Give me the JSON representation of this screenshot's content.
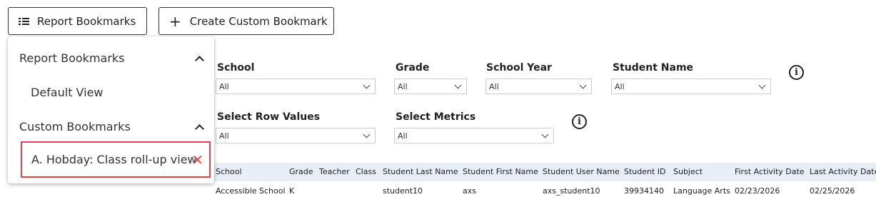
{
  "toolbar": {
    "report_bookmarks_label": "Report Bookmarks",
    "create_custom_label": "Create Custom Bookmark"
  },
  "menu": {
    "report_section": "Report Bookmarks",
    "default_view": "Default View",
    "custom_section": "Custom Bookmarks",
    "custom_item": "A. Hobday: Class roll-up view",
    "close_glyph": "✕"
  },
  "filters": {
    "school": {
      "label": "School",
      "value": "All"
    },
    "grade": {
      "label": "Grade",
      "value": "All"
    },
    "school_year": {
      "label": "School Year",
      "value": "All"
    },
    "student_name": {
      "label": "Student Name",
      "value": "All"
    },
    "row_values": {
      "label": "Select Row Values",
      "value": "All"
    },
    "metrics": {
      "label": "Select Metrics",
      "value": "All"
    }
  },
  "table": {
    "columns": [
      "School",
      "Grade",
      "Teacher",
      "Class",
      "Student Last Name",
      "Student First Name",
      "Student User Name",
      "Student ID",
      "Subject",
      "First Activity Date",
      "Last Activity Date"
    ],
    "rows": [
      [
        "Accessible School",
        "K",
        "",
        "",
        "student10",
        "axs",
        "axs_student10",
        "39934140",
        "Language Arts",
        "02/23/2026",
        "02/25/2026"
      ]
    ]
  },
  "colors": {
    "highlight_border": "#e0474c",
    "table_header_bg": "#e8edf7"
  },
  "icons": {
    "list": "list-icon",
    "plus": "plus-icon",
    "info": "info-icon",
    "close": "close-icon",
    "chevron_up": "chevron-up-icon",
    "chevron_down": "chevron-down-icon"
  }
}
